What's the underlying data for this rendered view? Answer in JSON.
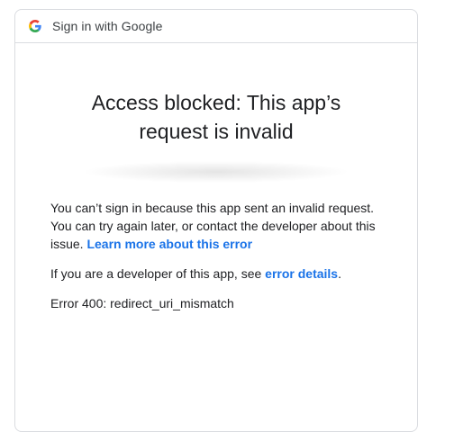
{
  "header": {
    "text": "Sign in with Google",
    "logo_icon": "google-g-logo"
  },
  "title": {
    "line1": "Access blocked: This app’s",
    "line2": "request is invalid"
  },
  "body": {
    "paragraph1_text": "You can’t sign in because this app sent an invalid request. You can try again later, or contact the developer about this issue.",
    "paragraph1_link": "Learn more about this error",
    "paragraph2_text": "If you are a developer of this app, see",
    "paragraph2_link": "error details",
    "paragraph2_suffix": ".",
    "error_code": "Error 400: redirect_uri_mismatch"
  },
  "colors": {
    "link": "#1a73e8",
    "border": "#dadce0",
    "text": "#202124"
  }
}
